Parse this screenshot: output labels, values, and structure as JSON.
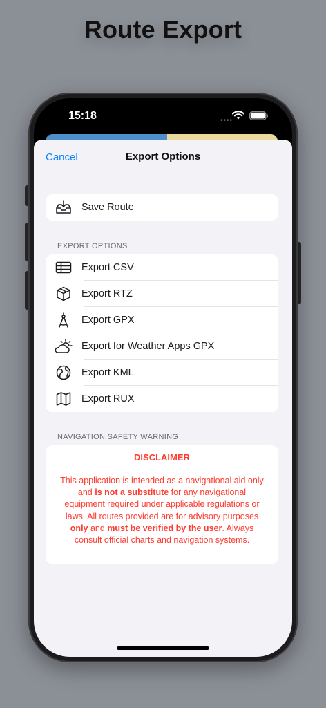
{
  "page_title": "Route Export",
  "status_bar": {
    "time": "15:18",
    "icons": [
      "wifi-icon",
      "battery-icon"
    ]
  },
  "nav": {
    "cancel_label": "Cancel",
    "title": "Export Options"
  },
  "save_group": {
    "items": [
      {
        "label": "Save Route",
        "icon": "tray-download-icon"
      }
    ]
  },
  "export_section": {
    "header": "EXPORT OPTIONS",
    "items": [
      {
        "label": "Export CSV",
        "icon": "table-icon"
      },
      {
        "label": "Export RTZ",
        "icon": "cube-icon"
      },
      {
        "label": "Export GPX",
        "icon": "compass-tool-icon"
      },
      {
        "label": "Export for Weather Apps GPX",
        "icon": "sun-cloud-icon"
      },
      {
        "label": "Export KML",
        "icon": "globe-icon"
      },
      {
        "label": "Export RUX",
        "icon": "map-icon"
      }
    ]
  },
  "safety_section": {
    "header": "NAVIGATION SAFETY WARNING",
    "title": "DISCLAIMER",
    "body_parts": [
      "This application is intended as a navigational aid only and ",
      "is not a substitute",
      " for any navigational equipment required under applicable regulations or laws. All routes provided are for advisory purposes ",
      "only",
      " and ",
      "must be verified by the user",
      ". Always consult official charts and navigation systems."
    ]
  },
  "colors": {
    "accent": "#0a84ff",
    "warning": "#ff3b30",
    "sheet_bg": "#f2f2f7",
    "backdrop": "#8b8f96"
  }
}
